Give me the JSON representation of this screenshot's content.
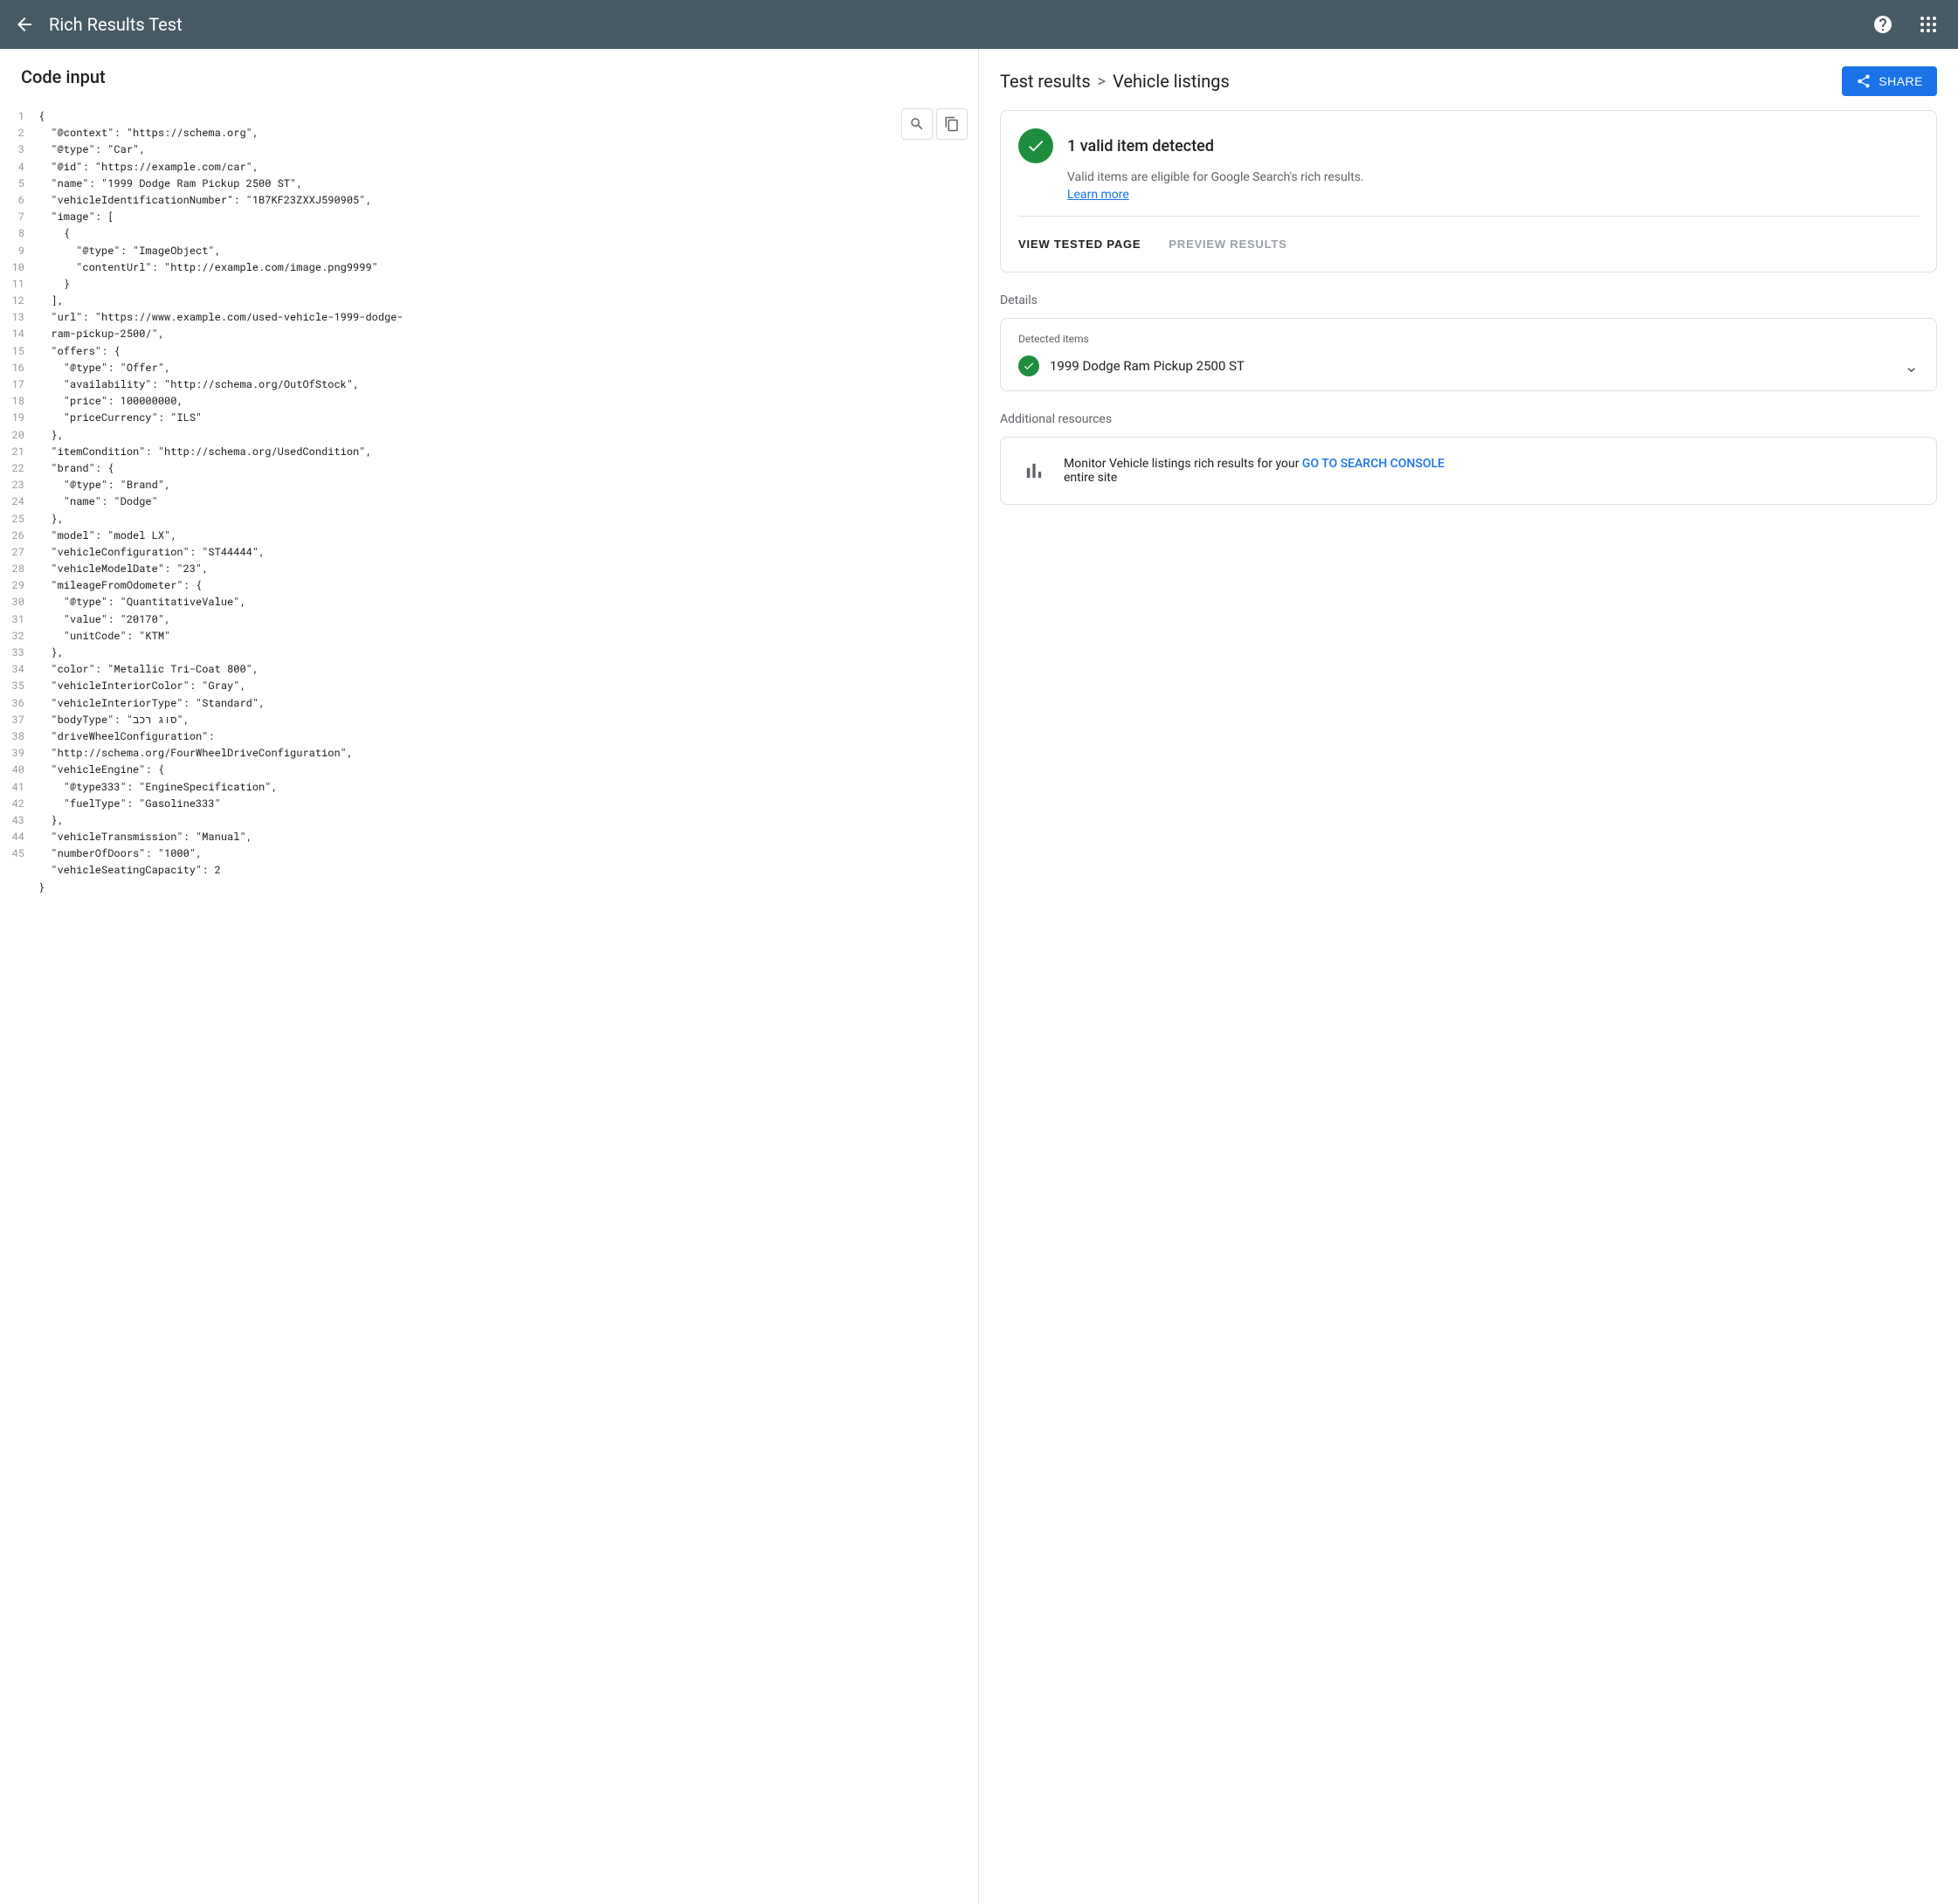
{
  "topbar": {
    "title": "Rich Results Test",
    "back_icon": "←",
    "help_icon": "?",
    "grid_icon": "⋮⋮⋮"
  },
  "left_panel": {
    "header": "Code input",
    "search_icon": "🔍",
    "copy_icon": "⧉",
    "code_lines": [
      "{",
      "  \"@context\": \"https://schema.org\",",
      "  \"@type\": \"Car\",",
      "  \"@id\": \"https://example.com/car\",",
      "  \"name\": \"1999 Dodge Ram Pickup 2500 ST\",",
      "  \"vehicleIdentificationNumber\": \"1B7KF23ZXXJ590905\",",
      "  \"image\": [",
      "    {",
      "      \"@type\": \"ImageObject\",",
      "      \"contentUrl\": \"http://example.com/image.png9999\"",
      "    }",
      "  ],",
      "  \"url\": \"https://www.example.com/used-vehicle-1999-dodge-ram-pickup-2500/\",",
      "  \"offers\": {",
      "    \"@type\": \"Offer\",",
      "    \"availability\": \"http://schema.org/OutOfStock\",",
      "    \"price\": 100000000,",
      "    \"priceCurrency\": \"ILS\"",
      "  },",
      "  \"itemCondition\": \"http://schema.org/UsedCondition\",",
      "  \"brand\": {",
      "    \"@type\": \"Brand\",",
      "    \"name\": \"Dodge\"",
      "  },",
      "  \"model\": \"model LX\",",
      "  \"vehicleConfiguration\": \"ST44444\",",
      "  \"vehicleModelDate\": \"23\",",
      "  \"mileageFromOdometer\": {",
      "    \"@type\": \"QuantitativeValue\",",
      "    \"value\": \"20170\",",
      "    \"unitCode\": \"KTM\"",
      "  },",
      "  \"color\": \"Metallic Tri-Coat 800\",",
      "  \"vehicleInteriorColor\": \"Gray\",",
      "  \"vehicleInteriorType\": \"Standard\",",
      "  \"bodyType\": \"סוג רכב\",",
      "  \"driveWheelConfiguration\": \"http://schema.org/FourWheelDriveConfiguration\",",
      "  \"vehicleEngine\": {",
      "    \"@type333\": \"EngineSpecification\",",
      "    \"fuelType\": \"Gasoline333\"",
      "  },",
      "  \"vehicleTransmission\": \"Manual\",",
      "  \"numberOfDoors\": \"1000\",",
      "  \"vehicleSeatingCapacity\": 2",
      "}"
    ],
    "line_count": 45
  },
  "right_panel": {
    "breadcrumb_link": "Test results",
    "breadcrumb_sep": ">",
    "breadcrumb_current": "Vehicle listings",
    "share_label": "SHARE",
    "valid_count": "1 valid item detected",
    "valid_desc": "Valid items are eligible for Google Search's rich results.",
    "learn_more": "Learn more",
    "view_tested_page": "VIEW TESTED PAGE",
    "preview_results": "PREVIEW RESULTS",
    "details_label": "Details",
    "detected_items_label": "Detected items",
    "detected_item_name": "1999 Dodge Ram Pickup 2500 ST",
    "additional_resources_label": "Additional resources",
    "monitor_text_before": "Monitor Vehicle listings rich results for your ",
    "monitor_link": "GO TO SEARCH CONSOLE",
    "monitor_text_after": "entire site",
    "monitor_link2": "GO TO SEARCH\nCONSOLE"
  }
}
